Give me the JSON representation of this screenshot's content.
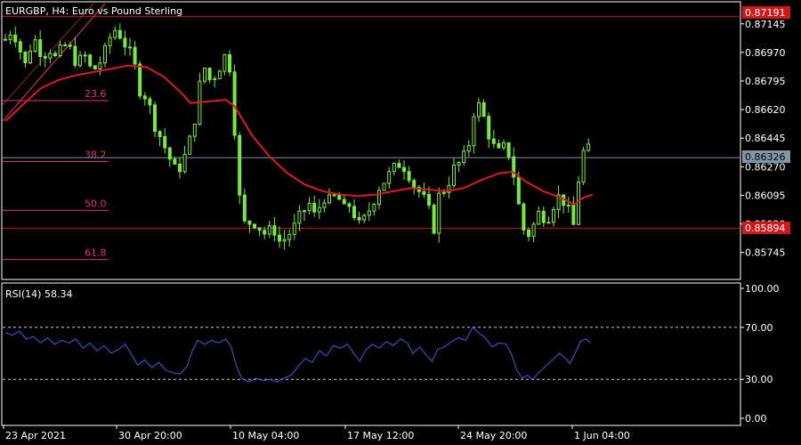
{
  "header": {
    "symbol_title": "EURGBP, H4:  Euro vs Pound Sterling",
    "rsi_label": "RSI(14) 58.34"
  },
  "colors": {
    "background": "#000000",
    "frame": "#ffffff",
    "candle": "#7ae843",
    "ma": "#e01a1a",
    "hline": "#d11717",
    "bid_line": "#8296a6",
    "fib": "#e0307a",
    "rsi": "#3b5fd6",
    "level_dash": "#c8c8c8"
  },
  "price_tags": {
    "top_line": "0.87191",
    "bid": "0.86326",
    "bottom_line": "0.85894"
  },
  "fibonacci": [
    {
      "label": "23.6",
      "price": 0.86675
    },
    {
      "label": "38.2",
      "price": 0.86302
    },
    {
      "label": "50.0",
      "price": 0.86003
    },
    {
      "label": "61.8",
      "price": 0.85702
    }
  ],
  "chart_data": [
    {
      "type": "candlestick",
      "title": "EURGBP, H4:  Euro vs Pound Sterling",
      "ylim": [
        0.8558,
        0.8728
      ],
      "yticks": [
        "0.87145",
        "0.86970",
        "0.86795",
        "0.86620",
        "0.86445",
        "0.86270",
        "0.86095",
        "0.85920",
        "0.85745"
      ],
      "ytick_values": [
        0.87145,
        0.8697,
        0.86795,
        0.8662,
        0.86445,
        0.8627,
        0.86095,
        0.8592,
        0.85745
      ],
      "xticks": [
        "23 Apr 2021",
        "30 Apr 20:00",
        "10 May 04:00",
        "17 May 12:00",
        "24 May 20:00",
        "1 Jun 04:00"
      ],
      "horizontal_lines": [
        0.87191,
        0.86326,
        0.85894
      ],
      "close_path": [
        [
          0,
          0.8705
        ],
        [
          8,
          0.8712
        ],
        [
          15,
          0.8702
        ],
        [
          22,
          0.8688
        ],
        [
          28,
          0.87
        ],
        [
          35,
          0.8705
        ],
        [
          42,
          0.8695
        ],
        [
          50,
          0.87
        ],
        [
          58,
          0.8692
        ],
        [
          66,
          0.8702
        ],
        [
          74,
          0.8698
        ],
        [
          82,
          0.869
        ],
        [
          90,
          0.8695
        ],
        [
          98,
          0.8685
        ],
        [
          106,
          0.869
        ],
        [
          114,
          0.8698
        ],
        [
          122,
          0.8712
        ],
        [
          130,
          0.8708
        ],
        [
          138,
          0.87
        ],
        [
          146,
          0.869
        ],
        [
          152,
          0.8675
        ],
        [
          160,
          0.867
        ],
        [
          168,
          0.8655
        ],
        [
          176,
          0.8645
        ],
        [
          184,
          0.8635
        ],
        [
          192,
          0.8625
        ],
        [
          200,
          0.8628
        ],
        [
          208,
          0.864
        ],
        [
          216,
          0.866
        ],
        [
          224,
          0.869
        ],
        [
          232,
          0.868
        ],
        [
          240,
          0.8685
        ],
        [
          248,
          0.8695
        ],
        [
          254,
          0.869
        ],
        [
          258,
          0.867
        ],
        [
          262,
          0.863
        ],
        [
          266,
          0.8605
        ],
        [
          272,
          0.859
        ],
        [
          280,
          0.8595
        ],
        [
          288,
          0.859
        ],
        [
          296,
          0.8585
        ],
        [
          304,
          0.859
        ],
        [
          312,
          0.858
        ],
        [
          320,
          0.8585
        ],
        [
          328,
          0.859
        ],
        [
          336,
          0.8598
        ],
        [
          344,
          0.8605
        ],
        [
          352,
          0.8595
        ],
        [
          360,
          0.861
        ],
        [
          368,
          0.8605
        ],
        [
          376,
          0.861
        ],
        [
          384,
          0.86
        ],
        [
          392,
          0.8605
        ],
        [
          400,
          0.859
        ],
        [
          408,
          0.8595
        ],
        [
          416,
          0.8605
        ],
        [
          424,
          0.8615
        ],
        [
          432,
          0.862
        ],
        [
          440,
          0.8625
        ],
        [
          448,
          0.863
        ],
        [
          456,
          0.8625
        ],
        [
          464,
          0.8615
        ],
        [
          472,
          0.861
        ],
        [
          480,
          0.86
        ],
        [
          486,
          0.859
        ],
        [
          492,
          0.861
        ],
        [
          500,
          0.8615
        ],
        [
          508,
          0.8625
        ],
        [
          516,
          0.863
        ],
        [
          524,
          0.8635
        ],
        [
          530,
          0.866
        ],
        [
          536,
          0.8665
        ],
        [
          544,
          0.8655
        ],
        [
          552,
          0.864
        ],
        [
          560,
          0.8635
        ],
        [
          568,
          0.864
        ],
        [
          574,
          0.863
        ],
        [
          580,
          0.861
        ],
        [
          586,
          0.859
        ],
        [
          592,
          0.8585
        ],
        [
          598,
          0.859
        ],
        [
          606,
          0.86
        ],
        [
          614,
          0.8595
        ],
        [
          622,
          0.8605
        ],
        [
          630,
          0.861
        ],
        [
          638,
          0.86
        ],
        [
          644,
          0.859
        ],
        [
          648,
          0.861
        ],
        [
          652,
          0.863
        ],
        [
          658,
          0.864
        ],
        [
          664,
          0.8634
        ]
      ],
      "series": [
        {
          "name": "",
          "kind": "moving_average",
          "points": [
            [
              0,
              0.8655
            ],
            [
              20,
              0.8665
            ],
            [
              40,
              0.8675
            ],
            [
              60,
              0.868
            ],
            [
              80,
              0.8683
            ],
            [
              100,
              0.8685
            ],
            [
              120,
              0.8687
            ],
            [
              140,
              0.8689
            ],
            [
              160,
              0.8688
            ],
            [
              180,
              0.8682
            ],
            [
              200,
              0.8672
            ],
            [
              210,
              0.8666
            ],
            [
              230,
              0.8667
            ],
            [
              250,
              0.8668
            ],
            [
              260,
              0.8664
            ],
            [
              280,
              0.8646
            ],
            [
              300,
              0.8633
            ],
            [
              320,
              0.8623
            ],
            [
              340,
              0.8616
            ],
            [
              360,
              0.8612
            ],
            [
              380,
              0.861
            ],
            [
              400,
              0.8609
            ],
            [
              420,
              0.861
            ],
            [
              440,
              0.8612
            ],
            [
              460,
              0.8614
            ],
            [
              480,
              0.8613
            ],
            [
              500,
              0.8612
            ],
            [
              520,
              0.8614
            ],
            [
              540,
              0.8619
            ],
            [
              560,
              0.8623
            ],
            [
              575,
              0.8624
            ],
            [
              590,
              0.8618
            ],
            [
              610,
              0.8612
            ],
            [
              630,
              0.8608
            ],
            [
              645,
              0.8604
            ],
            [
              655,
              0.8608
            ],
            [
              666,
              0.861
            ]
          ]
        }
      ]
    },
    {
      "type": "line",
      "title": "RSI(14) 58.34",
      "ylim": [
        0,
        100
      ],
      "yticks": [
        "100.00",
        "70.00",
        "30.00",
        "0.00"
      ],
      "ytick_values": [
        100,
        70,
        30,
        0
      ],
      "levels": [
        70,
        30
      ],
      "series": [
        {
          "name": "",
          "points": [
            [
              0,
              66
            ],
            [
              8,
              64
            ],
            [
              16,
              67
            ],
            [
              24,
              61
            ],
            [
              32,
              63
            ],
            [
              40,
              58
            ],
            [
              48,
              62
            ],
            [
              56,
              57
            ],
            [
              64,
              60
            ],
            [
              72,
              58
            ],
            [
              80,
              61
            ],
            [
              88,
              54
            ],
            [
              96,
              58
            ],
            [
              104,
              52
            ],
            [
              112,
              56
            ],
            [
              120,
              50
            ],
            [
              128,
              53
            ],
            [
              136,
              57
            ],
            [
              144,
              48
            ],
            [
              150,
              41
            ],
            [
              158,
              45
            ],
            [
              166,
              39
            ],
            [
              174,
              43
            ],
            [
              182,
              37
            ],
            [
              190,
              35
            ],
            [
              198,
              34
            ],
            [
              206,
              40
            ],
            [
              212,
              52
            ],
            [
              218,
              60
            ],
            [
              226,
              57
            ],
            [
              234,
              60
            ],
            [
              242,
              58
            ],
            [
              250,
              61
            ],
            [
              256,
              55
            ],
            [
              262,
              40
            ],
            [
              268,
              31
            ],
            [
              276,
              28
            ],
            [
              284,
              31
            ],
            [
              292,
              29
            ],
            [
              300,
              30
            ],
            [
              308,
              28
            ],
            [
              316,
              31
            ],
            [
              324,
              33
            ],
            [
              332,
              40
            ],
            [
              340,
              46
            ],
            [
              348,
              43
            ],
            [
              356,
              52
            ],
            [
              364,
              48
            ],
            [
              372,
              56
            ],
            [
              380,
              54
            ],
            [
              388,
              57
            ],
            [
              396,
              49
            ],
            [
              402,
              44
            ],
            [
              408,
              52
            ],
            [
              416,
              57
            ],
            [
              424,
              54
            ],
            [
              432,
              59
            ],
            [
              440,
              56
            ],
            [
              448,
              61
            ],
            [
              456,
              58
            ],
            [
              462,
              50
            ],
            [
              470,
              55
            ],
            [
              478,
              48
            ],
            [
              484,
              44
            ],
            [
              490,
              53
            ],
            [
              498,
              55
            ],
            [
              506,
              59
            ],
            [
              514,
              62
            ],
            [
              522,
              60
            ],
            [
              530,
              70
            ],
            [
              536,
              66
            ],
            [
              544,
              62
            ],
            [
              552,
              55
            ],
            [
              560,
              58
            ],
            [
              568,
              57
            ],
            [
              574,
              49
            ],
            [
              580,
              37
            ],
            [
              586,
              31
            ],
            [
              592,
              33
            ],
            [
              598,
              30
            ],
            [
              606,
              36
            ],
            [
              614,
              41
            ],
            [
              622,
              46
            ],
            [
              628,
              50
            ],
            [
              634,
              47
            ],
            [
              640,
              42
            ],
            [
              646,
              50
            ],
            [
              652,
              59
            ],
            [
              658,
              61
            ],
            [
              664,
              58
            ]
          ]
        }
      ]
    }
  ]
}
